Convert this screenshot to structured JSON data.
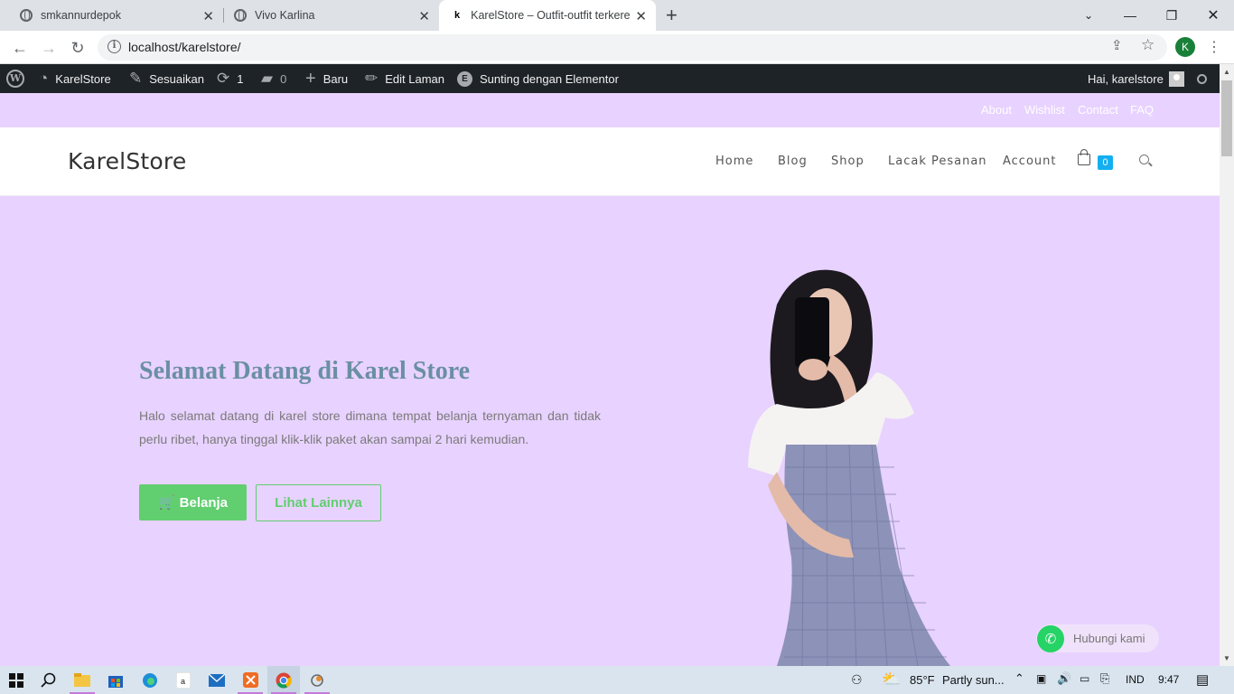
{
  "browser": {
    "tabs": [
      {
        "title": "smkannurdepok",
        "active": false
      },
      {
        "title": "Vivo Karlina",
        "active": false
      },
      {
        "title": "KarelStore – Outfit-outfit terkeren",
        "active": true,
        "favicon": "k"
      }
    ],
    "url": "localhost/karelstore/",
    "profile_initial": "K"
  },
  "adminbar": {
    "site_name": "KarelStore",
    "customize": "Sesuaikan",
    "updates_count": "1",
    "comments_count": "0",
    "new_label": "Baru",
    "edit_page": "Edit Laman",
    "elementor": "Sunting dengan Elementor",
    "greeting": "Hai, karelstore"
  },
  "topbar": {
    "links": [
      "About",
      "Wishlist",
      "Contact",
      "FAQ"
    ]
  },
  "header": {
    "logo": "KarelStore",
    "nav": [
      "Home",
      "Blog",
      "Shop",
      "Lacak Pesanan",
      "Account"
    ],
    "cart_count": "0"
  },
  "hero": {
    "title": "Selamat Datang di Karel Store",
    "description": "Halo selamat datang di karel store dimana tempat belanja ternyaman dan tidak perlu ribet, hanya tinggal klik-klik paket akan sampai 2 hari kemudian.",
    "btn_primary": "Belanja",
    "btn_secondary": "Lihat Lainnya"
  },
  "whatsapp": {
    "label": "Hubungi kami"
  },
  "taskbar": {
    "weather_temp": "85°F",
    "weather_text": "Partly sun...",
    "language": "IND",
    "time": "9:47"
  },
  "colors": {
    "hero_bg": "#e8d2ff",
    "title_color": "#6a8fa3",
    "button_green": "#61ce70",
    "adminbar_bg": "#1d2327",
    "cart_badge": "#13aff0"
  }
}
